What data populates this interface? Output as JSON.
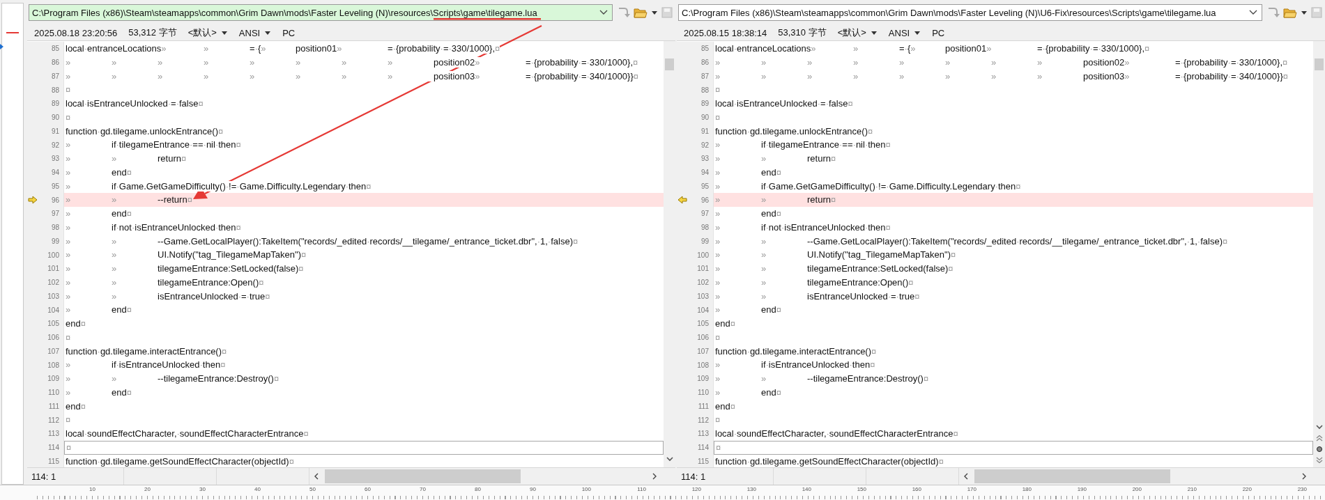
{
  "panes": [
    {
      "path": "C:\\Program Files (x86)\\Steam\\steamapps\\common\\Grim Dawn\\mods\\Faster Leveling (N)\\resources\\Scripts\\game\\tilegame.lua",
      "path_highlighted": true,
      "info": {
        "timestamp": "2025.08.18 23:20:56",
        "size": "53,312 字节",
        "codepage": "<默认>",
        "encoding": "ANSI",
        "line_ending": "PC"
      },
      "lines": [
        {
          "number": "85",
          "text": "local·entranceLocations»\t»\t=·{»\tposition01»\t=·{probability·=·330/1000},¤",
          "changed": false,
          "current": false
        },
        {
          "number": "86",
          "text": "»\t»\t»\t»\t»\t»\t»\t»\tposition02»\t=·{probability·=·330/1000},¤",
          "changed": false,
          "current": false
        },
        {
          "number": "87",
          "text": "»\t»\t»\t»\t»\t»\t»\t»\tposition03»\t=·{probability·=·340/1000}}¤",
          "changed": false,
          "current": false
        },
        {
          "number": "88",
          "text": "¤",
          "changed": false,
          "current": false
        },
        {
          "number": "89",
          "text": "local·isEntranceUnlocked·=·false¤",
          "changed": false,
          "current": false
        },
        {
          "number": "90",
          "text": "¤",
          "changed": false,
          "current": false
        },
        {
          "number": "91",
          "text": "function·gd.tilegame.unlockEntrance()¤",
          "changed": false,
          "current": false
        },
        {
          "number": "92",
          "text": "»\tif·tilegameEntrance·==·nil·then¤",
          "changed": false,
          "current": false
        },
        {
          "number": "93",
          "text": "»\t»\treturn¤",
          "changed": false,
          "current": false
        },
        {
          "number": "94",
          "text": "»\tend¤",
          "changed": false,
          "current": false
        },
        {
          "number": "95",
          "text": "»\tif·Game.GetGameDifficulty()·!=·Game.Difficulty.Legendary·then¤",
          "changed": false,
          "current": false
        },
        {
          "number": "96",
          "text": "»\t»\t--return¤",
          "changed": true,
          "current": false
        },
        {
          "number": "97",
          "text": "»\tend¤",
          "changed": false,
          "current": false
        },
        {
          "number": "98",
          "text": "»\tif·not·isEntranceUnlocked·then¤",
          "changed": false,
          "current": false
        },
        {
          "number": "99",
          "text": "»\t»\t--Game.GetLocalPlayer():TakeItem(\"records/_edited·records/__tilegame/_entrance_ticket.dbr\",·1,·false)¤",
          "changed": false,
          "current": false
        },
        {
          "number": "100",
          "text": "»\t»\tUI.Notify(\"tag_TilegameMapTaken\")¤",
          "changed": false,
          "current": false
        },
        {
          "number": "101",
          "text": "»\t»\ttilegameEntrance:SetLocked(false)¤",
          "changed": false,
          "current": false
        },
        {
          "number": "102",
          "text": "»\t»\ttilegameEntrance:Open()¤",
          "changed": false,
          "current": false
        },
        {
          "number": "103",
          "text": "»\t»\tisEntranceUnlocked·=·true¤",
          "changed": false,
          "current": false
        },
        {
          "number": "104",
          "text": "»\tend¤",
          "changed": false,
          "current": false
        },
        {
          "number": "105",
          "text": "end¤",
          "changed": false,
          "current": false
        },
        {
          "number": "106",
          "text": "¤",
          "changed": false,
          "current": false
        },
        {
          "number": "107",
          "text": "function·gd.tilegame.interactEntrance()¤",
          "changed": false,
          "current": false
        },
        {
          "number": "108",
          "text": "»\tif·isEntranceUnlocked·then¤",
          "changed": false,
          "current": false
        },
        {
          "number": "109",
          "text": "»\t»\t--tilegameEntrance:Destroy()¤",
          "changed": false,
          "current": false
        },
        {
          "number": "110",
          "text": "»\tend¤",
          "changed": false,
          "current": false
        },
        {
          "number": "111",
          "text": "end¤",
          "changed": false,
          "current": false
        },
        {
          "number": "112",
          "text": "¤",
          "changed": false,
          "current": false
        },
        {
          "number": "113",
          "text": "local·soundEffectCharacter,·soundEffectCharacterEntrance¤",
          "changed": false,
          "current": false
        },
        {
          "number": "114",
          "text": "¤",
          "changed": false,
          "current": true
        },
        {
          "number": "115",
          "text": "function·gd.tilegame.getSoundEffectCharacter(objectId)¤",
          "changed": false,
          "current": false
        }
      ],
      "position": "114: 1"
    },
    {
      "path": "C:\\Program Files (x86)\\Steam\\steamapps\\common\\Grim Dawn\\mods\\Faster Leveling (N)\\U6-Fix\\resources\\Scripts\\game\\tilegame.lua",
      "path_highlighted": false,
      "info": {
        "timestamp": "2025.08.15 18:38:14",
        "size": "53,310 字节",
        "codepage": "<默认>",
        "encoding": "ANSI",
        "line_ending": "PC"
      },
      "lines": [
        {
          "number": "85",
          "text": "local·entranceLocations»\t»\t=·{»\tposition01»\t=·{probability·=·330/1000},¤",
          "changed": false,
          "current": false
        },
        {
          "number": "86",
          "text": "»\t»\t»\t»\t»\t»\t»\t»\tposition02»\t=·{probability·=·330/1000},¤",
          "changed": false,
          "current": false
        },
        {
          "number": "87",
          "text": "»\t»\t»\t»\t»\t»\t»\t»\tposition03»\t=·{probability·=·340/1000}}¤",
          "changed": false,
          "current": false
        },
        {
          "number": "88",
          "text": "¤",
          "changed": false,
          "current": false
        },
        {
          "number": "89",
          "text": "local·isEntranceUnlocked·=·false¤",
          "changed": false,
          "current": false
        },
        {
          "number": "90",
          "text": "¤",
          "changed": false,
          "current": false
        },
        {
          "number": "91",
          "text": "function·gd.tilegame.unlockEntrance()¤",
          "changed": false,
          "current": false
        },
        {
          "number": "92",
          "text": "»\tif·tilegameEntrance·==·nil·then¤",
          "changed": false,
          "current": false
        },
        {
          "number": "93",
          "text": "»\t»\treturn¤",
          "changed": false,
          "current": false
        },
        {
          "number": "94",
          "text": "»\tend¤",
          "changed": false,
          "current": false
        },
        {
          "number": "95",
          "text": "»\tif·Game.GetGameDifficulty()·!=·Game.Difficulty.Legendary·then¤",
          "changed": false,
          "current": false
        },
        {
          "number": "96",
          "text": "»\t»\treturn¤",
          "changed": true,
          "current": false
        },
        {
          "number": "97",
          "text": "»\tend¤",
          "changed": false,
          "current": false
        },
        {
          "number": "98",
          "text": "»\tif·not·isEntranceUnlocked·then¤",
          "changed": false,
          "current": false
        },
        {
          "number": "99",
          "text": "»\t»\t--Game.GetLocalPlayer():TakeItem(\"records/_edited·records/__tilegame/_entrance_ticket.dbr\",·1,·false)¤",
          "changed": false,
          "current": false
        },
        {
          "number": "100",
          "text": "»\t»\tUI.Notify(\"tag_TilegameMapTaken\")¤",
          "changed": false,
          "current": false
        },
        {
          "number": "101",
          "text": "»\t»\ttilegameEntrance:SetLocked(false)¤",
          "changed": false,
          "current": false
        },
        {
          "number": "102",
          "text": "»\t»\ttilegameEntrance:Open()¤",
          "changed": false,
          "current": false
        },
        {
          "number": "103",
          "text": "»\t»\tisEntranceUnlocked·=·true¤",
          "changed": false,
          "current": false
        },
        {
          "number": "104",
          "text": "»\tend¤",
          "changed": false,
          "current": false
        },
        {
          "number": "105",
          "text": "end¤",
          "changed": false,
          "current": false
        },
        {
          "number": "106",
          "text": "¤",
          "changed": false,
          "current": false
        },
        {
          "number": "107",
          "text": "function·gd.tilegame.interactEntrance()¤",
          "changed": false,
          "current": false
        },
        {
          "number": "108",
          "text": "»\tif·isEntranceUnlocked·then¤",
          "changed": false,
          "current": false
        },
        {
          "number": "109",
          "text": "»\t»\t--tilegameEntrance:Destroy()¤",
          "changed": false,
          "current": false
        },
        {
          "number": "110",
          "text": "»\tend¤",
          "changed": false,
          "current": false
        },
        {
          "number": "111",
          "text": "end¤",
          "changed": false,
          "current": false
        },
        {
          "number": "112",
          "text": "¤",
          "changed": false,
          "current": false
        },
        {
          "number": "113",
          "text": "local·soundEffectCharacter,·soundEffectCharacterEntrance¤",
          "changed": false,
          "current": false
        },
        {
          "number": "114",
          "text": "¤",
          "changed": false,
          "current": true
        },
        {
          "number": "115",
          "text": "function·gd.tilegame.getSoundEffectCharacter(objectId)¤",
          "changed": false,
          "current": false
        }
      ],
      "position": "114: 1"
    }
  ],
  "ruler": [
    "10",
    "20",
    "30",
    "40",
    "50",
    "60",
    "70",
    "80",
    "90",
    "100",
    "110",
    "120",
    "130",
    "140",
    "150",
    "160",
    "170",
    "180",
    "190",
    "200",
    "210",
    "220",
    "230"
  ],
  "annotations": [
    {
      "kind": "arrow",
      "underline": true,
      "color": "#e53935"
    }
  ]
}
